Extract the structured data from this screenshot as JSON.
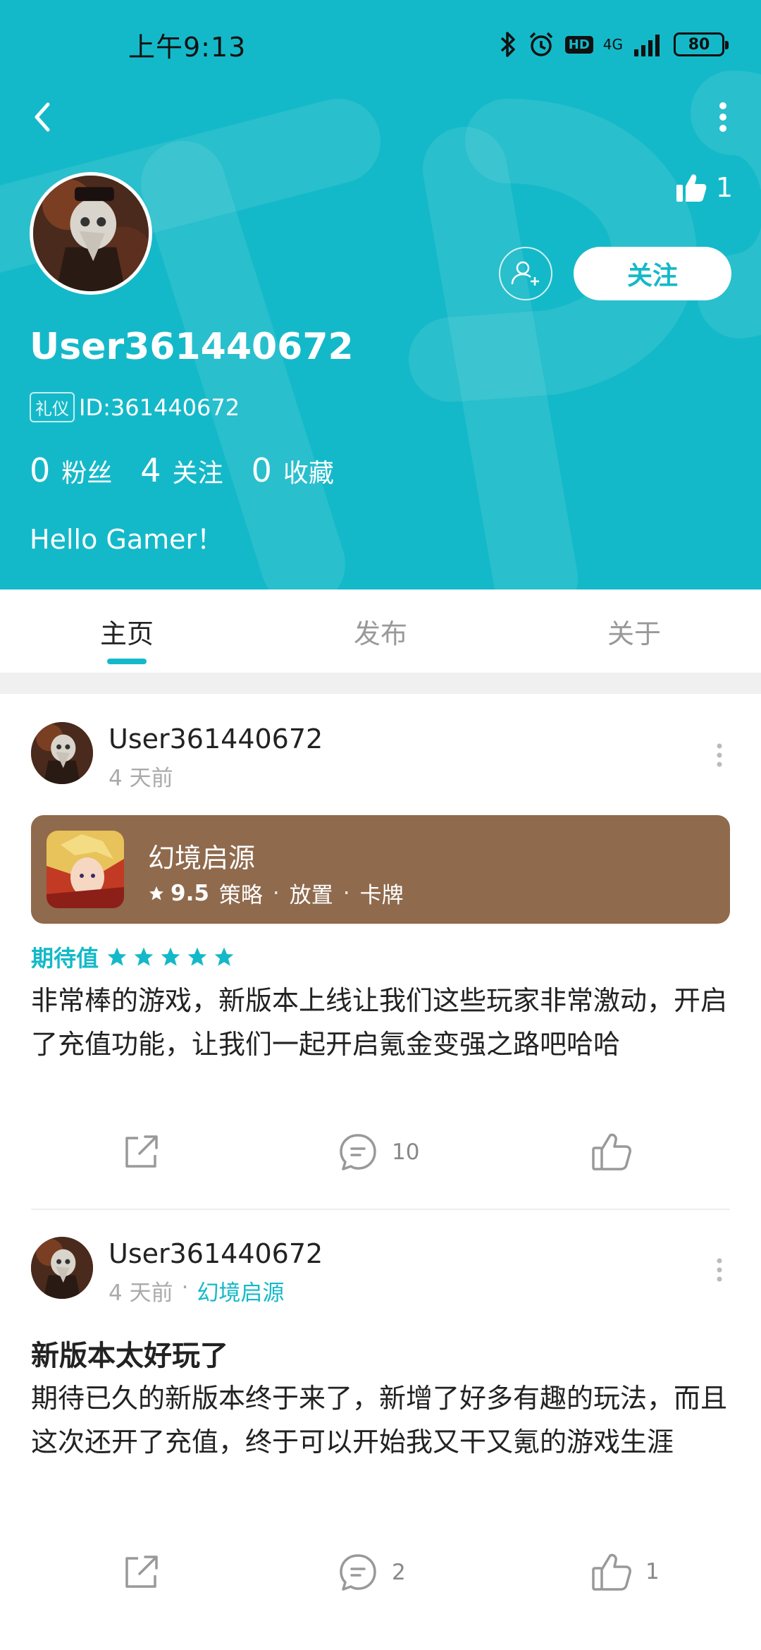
{
  "status_bar": {
    "time": "上午9:13",
    "network": "4G",
    "hd": "HD",
    "battery": "80"
  },
  "profile": {
    "like_count": "1",
    "follow_label": "关注",
    "username": "User361440672",
    "badge": "礼仪",
    "id_text": "ID:361440672",
    "stats": [
      {
        "num": "0",
        "label": "粉丝"
      },
      {
        "num": "4",
        "label": "关注"
      },
      {
        "num": "0",
        "label": "收藏"
      }
    ],
    "bio": "Hello Gamer！"
  },
  "tabs": [
    {
      "label": "主页",
      "active": true
    },
    {
      "label": "发布",
      "active": false
    },
    {
      "label": "关于",
      "active": false
    }
  ],
  "posts": [
    {
      "user": "User361440672",
      "time": "4 天前",
      "game": {
        "name": "幻境启源",
        "score": "9.5",
        "tags": [
          "策略",
          "放置",
          "卡牌"
        ]
      },
      "expect_label": "期待值",
      "expect_rating": 5,
      "text": "非常棒的游戏，新版本上线让我们这些玩家非常激动，开启了充值功能，让我们一起开启氪金变强之路吧哈哈",
      "comment_count": "10",
      "like_count": ""
    },
    {
      "user": "User361440672",
      "time": "4 天前",
      "game_link": "幻境启源",
      "title": "新版本太好玩了",
      "text": "期待已久的新版本终于来了，新增了好多有趣的玩法，而且这次还开了充值，终于可以开始我又干又氪的游戏生涯",
      "comment_count": "2",
      "like_count": "1"
    }
  ],
  "colors": {
    "accent": "#14b9c9",
    "game_card": "#8f6a4d"
  },
  "icons": [
    "back-arrow-icon",
    "more-vertical-icon",
    "thumbs-up-icon",
    "add-friend-icon",
    "share-icon",
    "comment-icon",
    "star-icon",
    "bluetooth-icon",
    "alarm-icon",
    "signal-icon",
    "battery-icon"
  ]
}
